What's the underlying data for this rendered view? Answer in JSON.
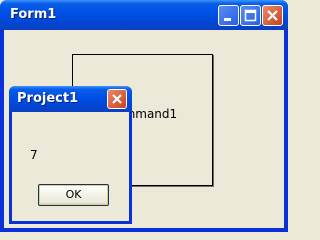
{
  "form": {
    "title": "Form1",
    "command_button_label": "Command1"
  },
  "dialog": {
    "title": "Project1",
    "message": "7",
    "ok_label": "OK"
  }
}
